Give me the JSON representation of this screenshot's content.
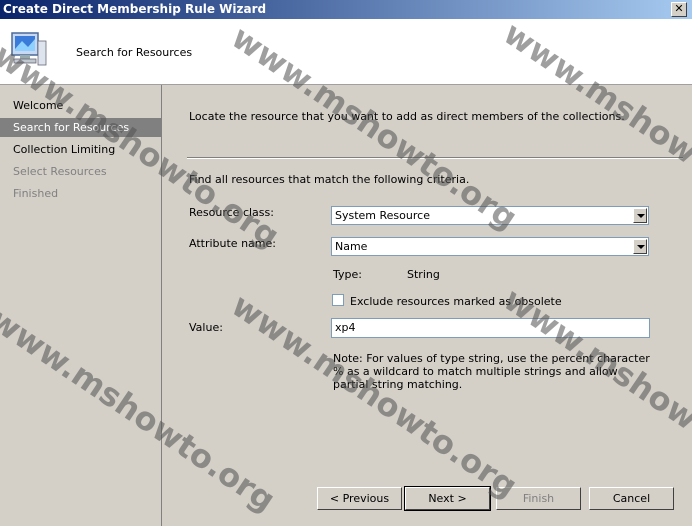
{
  "window": {
    "title": "Create Direct Membership Rule Wizard",
    "close_glyph": "✕"
  },
  "header": {
    "title": "Search for Resources"
  },
  "sidebar": {
    "items": [
      {
        "label": "Welcome",
        "state": "normal"
      },
      {
        "label": "Search for Resources",
        "state": "active"
      },
      {
        "label": "Collection Limiting",
        "state": "normal"
      },
      {
        "label": "Select Resources",
        "state": "disabled"
      },
      {
        "label": "Finished",
        "state": "disabled"
      }
    ]
  },
  "main": {
    "intro": "Locate the resource that you want to add as direct members of the collections.",
    "criteria": "Find all resources that match the following criteria.",
    "resource_class_label": "Resource class:",
    "resource_class_value": "System Resource",
    "attribute_name_label": "Attribute name:",
    "attribute_name_value": "Name",
    "type_label": "Type:",
    "type_value": "String",
    "exclude_label": "Exclude resources marked as obsolete",
    "exclude_checked": false,
    "value_label": "Value:",
    "value_value": "xp4",
    "note": "Note: For values of type string, use the percent character % as a wildcard to match multiple strings and allow partial string matching."
  },
  "buttons": {
    "previous": "< Previous",
    "next": "Next >",
    "finish": "Finish",
    "cancel": "Cancel"
  },
  "watermark": "www.mshowto.org"
}
